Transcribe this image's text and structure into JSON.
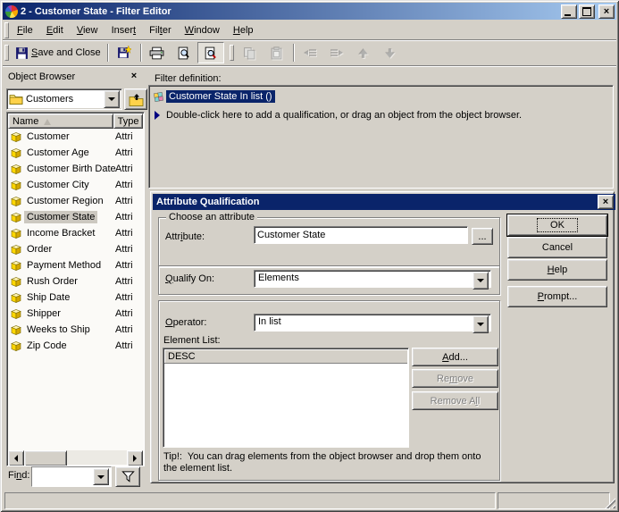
{
  "colors": {
    "face": "#D4D0C8",
    "title-start": "#0A246A",
    "title-end": "#A6CAF0",
    "sel-bg": "#0A246A",
    "list-sel": "#CCC8C0"
  },
  "icons": {
    "close_glyph": "×"
  },
  "window": {
    "title": "2 - Customer State - Filter Editor"
  },
  "menu_bar": {
    "items": [
      {
        "text": "File",
        "accel": 0
      },
      {
        "text": "Edit",
        "accel": 0
      },
      {
        "text": "View",
        "accel": 0
      },
      {
        "text": "Insert",
        "accel": 5
      },
      {
        "text": "Filter",
        "accel": 3
      },
      {
        "text": "Window",
        "accel": 0
      },
      {
        "text": "Help",
        "accel": 0
      }
    ]
  },
  "toolbar": {
    "save_and_close": {
      "text": "Save and Close",
      "accel": 0
    }
  },
  "object_browser": {
    "title": "Object Browser",
    "folder": "Customers",
    "columns": {
      "name": "Name",
      "type": "Type"
    },
    "selected": "Customer State",
    "items": [
      {
        "name": "Customer",
        "type": "Attri"
      },
      {
        "name": "Customer Age",
        "type": "Attri"
      },
      {
        "name": "Customer Birth Date",
        "type": "Attri"
      },
      {
        "name": "Customer City",
        "type": "Attri"
      },
      {
        "name": "Customer Region",
        "type": "Attri"
      },
      {
        "name": "Customer State",
        "type": "Attri"
      },
      {
        "name": "Income Bracket",
        "type": "Attri"
      },
      {
        "name": "Order",
        "type": "Attri"
      },
      {
        "name": "Payment Method",
        "type": "Attri"
      },
      {
        "name": "Rush Order",
        "type": "Attri"
      },
      {
        "name": "Ship Date",
        "type": "Attri"
      },
      {
        "name": "Shipper",
        "type": "Attri"
      },
      {
        "name": "Weeks to Ship",
        "type": "Attri"
      },
      {
        "name": "Zip Code",
        "type": "Attri"
      }
    ],
    "find_label": {
      "text": "Find:",
      "accel": 2
    },
    "find_value": ""
  },
  "filter_definition": {
    "label": "Filter definition:",
    "selected_qualification": "Customer State In list ()",
    "hint": "Double-click here to add a qualification, or drag an object from the object browser."
  },
  "dialog": {
    "title": "Attribute Qualification",
    "choose_attribute": {
      "legend": "Choose an attribute",
      "attribute_label": {
        "text": "Attribute:",
        "accel": 4
      },
      "attribute_value": "Customer State",
      "browse": "..."
    },
    "qualify_on": {
      "label": {
        "text": "Qualify On:",
        "accel": 0
      },
      "value": "Elements"
    },
    "operator": {
      "label": {
        "text": "Operator:",
        "accel": 0
      },
      "value": "In list"
    },
    "element_list": {
      "label": "Element List:",
      "header": "DESC",
      "items": []
    },
    "element_buttons": {
      "add": {
        "text": "Add...",
        "accel": 0
      },
      "remove": {
        "text": "Remove",
        "accel": 2
      },
      "remove_all": {
        "text": "Remove All",
        "accel": 8
      }
    },
    "tip": "Tip!:  You can drag elements from the object browser and drop them onto the element list.",
    "action_buttons": {
      "ok": "OK",
      "cancel": "Cancel",
      "help": {
        "text": "Help",
        "accel": 0
      },
      "prompt": {
        "text": "Prompt...",
        "accel": 0
      }
    }
  }
}
